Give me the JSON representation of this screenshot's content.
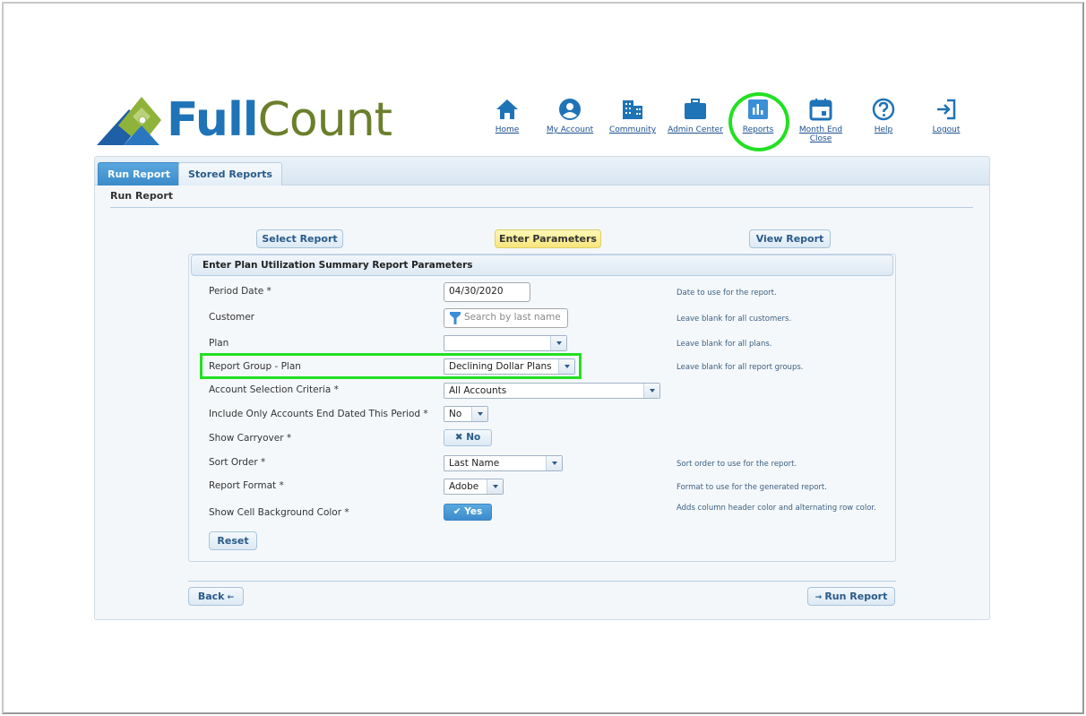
{
  "app": {
    "logo_full": "Full",
    "logo_count": "Count"
  },
  "nav": {
    "items": [
      {
        "label": "Home",
        "icon": "home-icon"
      },
      {
        "label": "My Account",
        "icon": "user-icon"
      },
      {
        "label": "Community",
        "icon": "building-icon"
      },
      {
        "label": "Admin Center",
        "icon": "briefcase-icon"
      },
      {
        "label": "Reports",
        "icon": "bar-chart-icon"
      },
      {
        "label": "Month End Close",
        "icon": "calendar-icon"
      },
      {
        "label": "Help",
        "icon": "help-icon"
      },
      {
        "label": "Logout",
        "icon": "logout-icon"
      }
    ],
    "selected": "Reports",
    "accent": "#1f73b7",
    "highlight_color": "#22e022"
  },
  "tabs": {
    "run_report": "Run Report",
    "stored_reports": "Stored Reports"
  },
  "page_subtitle": "Run Report",
  "steps": {
    "select_report": "Select Report",
    "enter_parameters": "Enter Parameters",
    "view_report": "View Report"
  },
  "form": {
    "header": "Enter Plan Utilization Summary Report Parameters",
    "period_date": {
      "label": "Period Date *",
      "value": "04/30/2020",
      "hint": "Date to use for the report."
    },
    "customer": {
      "label": "Customer",
      "placeholder": "Search by last name",
      "hint": "Leave blank for all customers."
    },
    "plan": {
      "label": "Plan",
      "value": "",
      "hint": "Leave blank for all plans."
    },
    "report_group": {
      "label": "Report Group - Plan",
      "value": "Declining Dollar Plans",
      "hint": "Leave blank for all report groups."
    },
    "account_selection": {
      "label": "Account Selection Criteria *",
      "value": "All Accounts"
    },
    "end_dated": {
      "label": "Include Only Accounts End Dated This Period *",
      "value": "No"
    },
    "show_carryover": {
      "label": "Show Carryover *",
      "value": "No"
    },
    "sort_order": {
      "label": "Sort Order *",
      "value": "Last Name",
      "hint": "Sort order to use for the report."
    },
    "report_format": {
      "label": "Report Format *",
      "value": "Adobe",
      "hint": "Format to use for the generated report."
    },
    "cell_bg": {
      "label": "Show Cell Background Color *",
      "value": "Yes",
      "hint": "Adds column header color and alternating row color."
    },
    "reset": "Reset"
  },
  "footer": {
    "back": "Back",
    "run_report": "Run Report"
  }
}
